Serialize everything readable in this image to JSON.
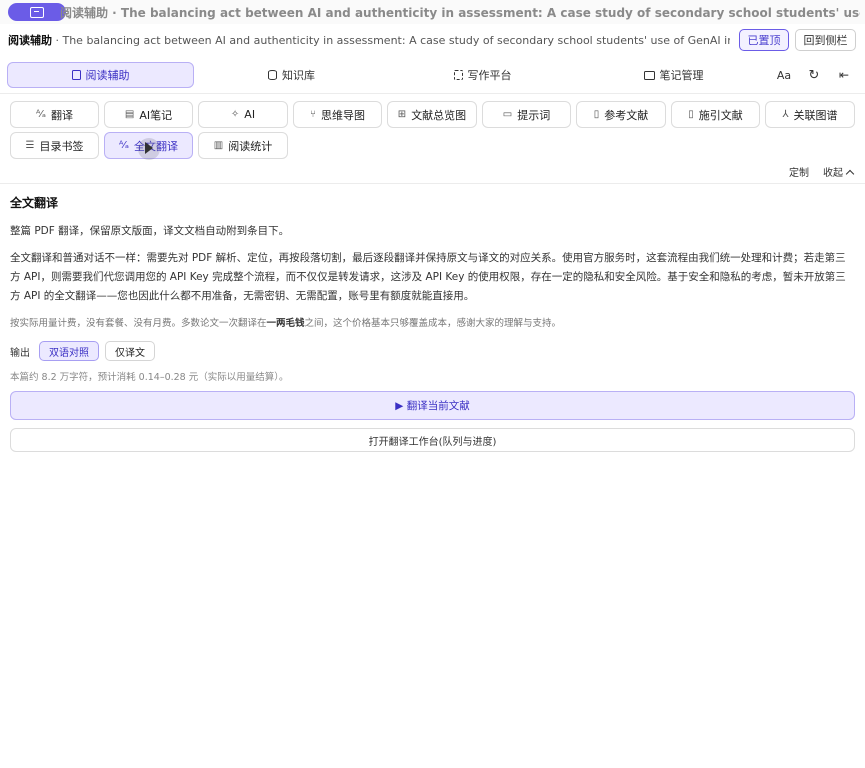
{
  "window": {
    "title": "阅读辅助 · The balancing act between AI and authenticity in assessment: A case study of secondary school students' use of GenAI in reflective wr..."
  },
  "header": {
    "app_name": "阅读辅助",
    "doc_title": " · The balancing act between AI and authenticity in assessment: A case study of secondary school students' use of GenAI in reflective wri...",
    "pin_label": "已置顶",
    "sidebar_label": "回到侧栏"
  },
  "nav": {
    "tabs": [
      {
        "label": "阅读辅助",
        "icon": "document-icon"
      },
      {
        "label": "知识库",
        "icon": "database-icon"
      },
      {
        "label": "写作平台",
        "icon": "grid-icon"
      },
      {
        "label": "笔记管理",
        "icon": "folder-icon"
      }
    ],
    "font_label": "Aa",
    "refresh_icon": "refresh-icon",
    "collapse_icon": "collapse-left-icon"
  },
  "tools": {
    "row1": [
      {
        "label": "翻译",
        "icon": "translate-icon"
      },
      {
        "label": "AI笔记",
        "icon": "note-icon"
      },
      {
        "label": "AI",
        "icon": "sparkle-icon"
      },
      {
        "label": "思维导图",
        "icon": "mindmap-icon"
      },
      {
        "label": "文献总览图",
        "icon": "overview-icon"
      },
      {
        "label": "提示词",
        "icon": "prompt-icon"
      },
      {
        "label": "参考文献",
        "icon": "reference-icon"
      },
      {
        "label": "施引文献",
        "icon": "citing-icon"
      },
      {
        "label": "关联图谱",
        "icon": "graph-icon"
      }
    ],
    "row2": [
      {
        "label": "目录书签",
        "icon": "list-icon"
      },
      {
        "label": "全文翻译",
        "icon": "translate-icon"
      },
      {
        "label": "阅读统计",
        "icon": "bar-chart-icon"
      }
    ],
    "customize_label": "定制",
    "collapse_label": "收起"
  },
  "content": {
    "title": "全文翻译",
    "intro": "整篇 PDF 翻译，保留原文版面，译文文档自动附到条目下。",
    "description": "全文翻译和普通对话不一样：需要先对 PDF 解析、定位，再按段落切割，最后逐段翻译并保持原文与译文的对应关系。使用官方服务时，这套流程由我们统一处理和计费；若走第三方 API，则需要我们代您调用您的 API Key 完成整个流程，而不仅仅是转发请求，这涉及 API Key 的使用权限，存在一定的隐私和安全风险。基于安全和隐私的考虑，暂未开放第三方 API 的全文翻译——您也因此什么都不用准备，无需密钥、无需配置，账号里有额度就能直接用。",
    "pricing_before": "按实际用量计费，没有套餐、没有月费。多数论文一次翻译在",
    "pricing_bold": "一两毛钱",
    "pricing_after": "之间，这个价格基本只够覆盖成本，感谢大家的理解与支持。",
    "output_label": "输出",
    "output_options": [
      "双语对照",
      "仅译文"
    ],
    "estimate": "本篇约 8.2 万字符，预计消耗 0.14–0.28 元（实际以用量结算）。",
    "translate_button": "▶ 翻译当前文献",
    "workbench_button": "打开翻译工作台(队列与进度)"
  },
  "colors": {
    "accent": "#6b5ce7",
    "accent_light": "#ece9ff",
    "accent_text": "#3b30c4"
  }
}
